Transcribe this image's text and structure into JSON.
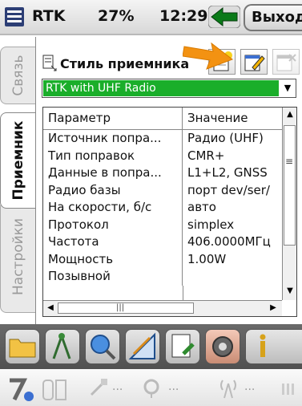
{
  "titlebar": {
    "app_title": "RTK",
    "battery": "27%",
    "clock": "12:29",
    "exit_label": "Выход"
  },
  "tabs": {
    "link": "Связь",
    "receiver": "Приемник",
    "settings": "Настройки"
  },
  "toolbar": {
    "style_label": "Стиль приемника"
  },
  "combo": {
    "selected": "RTK with UHF Radio"
  },
  "grid": {
    "headers": [
      "Параметр",
      "Значение"
    ],
    "rows": [
      [
        "Источник попра...",
        "Радио (UHF)"
      ],
      [
        "Тип поправок",
        "CMR+"
      ],
      [
        "Данные в попра...",
        "L1+L2, GNSS"
      ],
      [
        "Радио базы",
        "порт dev/ser/"
      ],
      [
        "На скорости, б/с",
        "авто"
      ],
      [
        "Протокол",
        "simplex"
      ],
      [
        "Частота",
        "406.0000МГц"
      ],
      [
        "Мощность",
        "1.00W"
      ],
      [
        "Позывной",
        ""
      ]
    ]
  },
  "bottombar": {
    "icons": [
      "folder-icon",
      "survey-person-icon",
      "search-globe-icon",
      "geometry-icon",
      "stakeout-icon",
      "gear-icon",
      "info-icon"
    ]
  },
  "statusbar": {
    "icons": [
      "gnss-status-icon",
      "tripod-icon",
      "satellite-icon",
      "satellite-dish-icon",
      "radio-icon",
      "more-icon"
    ],
    "dots": "..."
  },
  "colors": {
    "selection_green": "#1aae2a",
    "arrow_orange": "#f39212"
  }
}
